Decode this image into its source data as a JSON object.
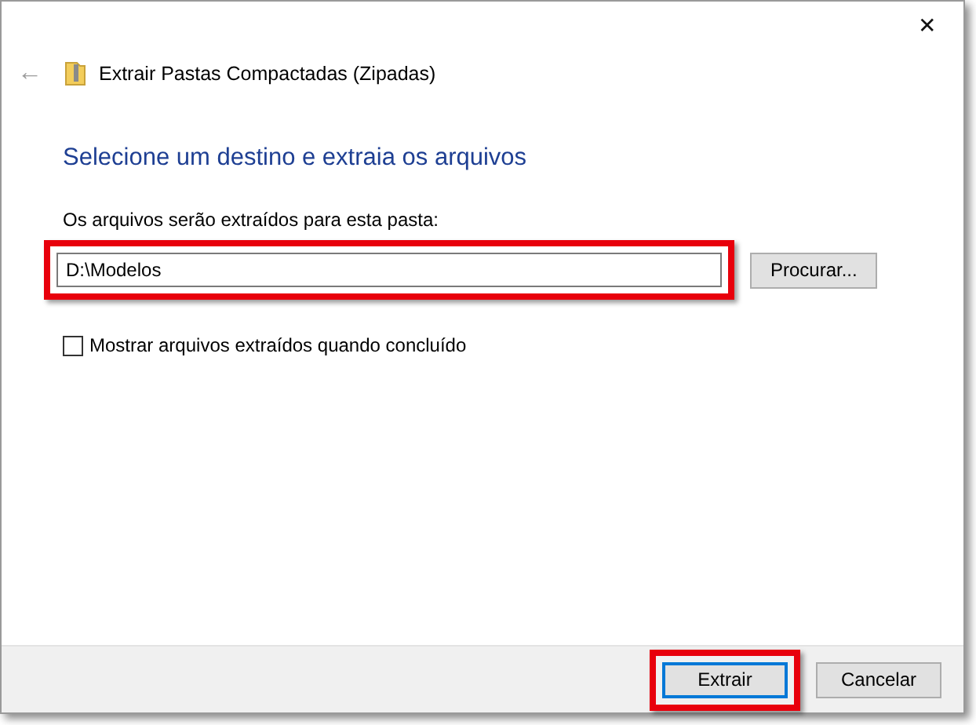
{
  "window": {
    "title": "Extrair Pastas Compactadas (Zipadas)",
    "close": "✕",
    "back": "←"
  },
  "heading": "Selecione um destino e extraia os arquivos",
  "destination": {
    "label": "Os arquivos serão extraídos para esta pasta:",
    "value": "D:\\Modelos",
    "highlighted": true
  },
  "browse_button": {
    "label": "Procurar..."
  },
  "show_files": {
    "label": "Mostrar arquivos extraídos quando concluído",
    "checked": false
  },
  "buttons": [
    {
      "label": "Extrair",
      "default": true,
      "highlighted": true
    },
    {
      "label": "Cancelar",
      "default": false,
      "highlighted": false
    }
  ]
}
